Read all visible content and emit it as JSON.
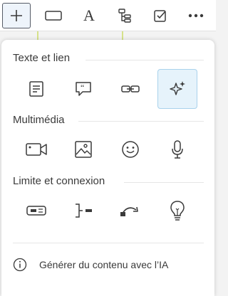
{
  "toolbar": {
    "tools": [
      {
        "icon": "plus-icon",
        "active": true
      },
      {
        "icon": "rectangle-icon",
        "active": false
      },
      {
        "icon": "text-icon",
        "glyph": "A",
        "active": false
      },
      {
        "icon": "hierarchy-icon",
        "active": false
      },
      {
        "icon": "checkbox-icon",
        "active": false
      },
      {
        "icon": "more-icon",
        "active": false
      }
    ]
  },
  "sections": [
    {
      "title": "Texte et lien",
      "items": [
        {
          "icon": "document-icon",
          "selected": false
        },
        {
          "icon": "quote-bubble-icon",
          "selected": false
        },
        {
          "icon": "link-icon",
          "selected": false
        },
        {
          "icon": "sparkles-icon",
          "selected": true
        }
      ]
    },
    {
      "title": "Multimédia",
      "items": [
        {
          "icon": "video-icon",
          "selected": false
        },
        {
          "icon": "image-icon",
          "selected": false
        },
        {
          "icon": "emoji-icon",
          "selected": false
        },
        {
          "icon": "microphone-icon",
          "selected": false
        }
      ]
    },
    {
      "title": "Limite et connexion",
      "items": [
        {
          "icon": "boundary-icon",
          "selected": false
        },
        {
          "icon": "bracket-connector-icon",
          "selected": false
        },
        {
          "icon": "curved-arrow-icon",
          "selected": false
        },
        {
          "icon": "lightbulb-icon",
          "selected": false
        }
      ]
    }
  ],
  "footer": {
    "icon": "info-icon",
    "label": "Générer du contenu avec l’IA"
  },
  "colors": {
    "accent_bg": "#e6f3fb",
    "accent_border": "#a9d2ec",
    "icon_stroke": "#3a3a3a"
  }
}
